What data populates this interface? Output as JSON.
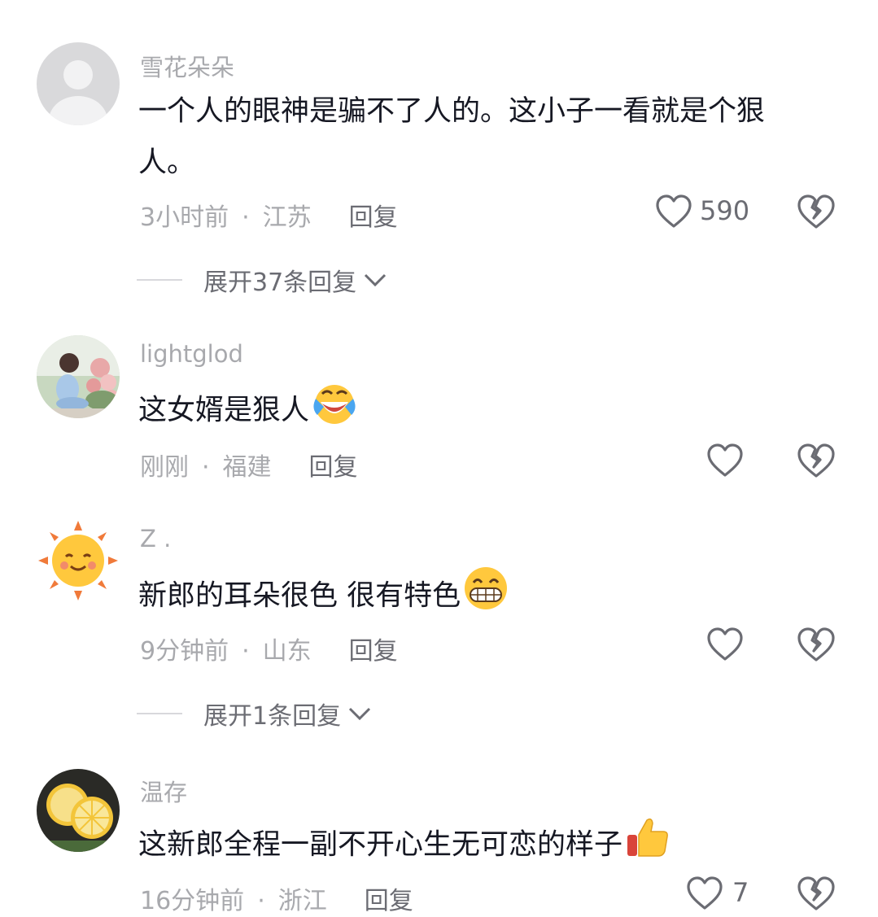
{
  "comments": [
    {
      "username": "雪花朵朵",
      "text": "一个人的眼神是骗不了人的。这小子一看就是个狠人。",
      "time": "3小时前",
      "location": "江苏",
      "reply_label": "回复",
      "like_count": "590",
      "expand_label": "展开37条回复",
      "avatar": "default-avatar"
    },
    {
      "username": "lightglod",
      "text": "这女婿是狠人",
      "emoji": "laughing-crying-emoji",
      "time": "刚刚",
      "location": "福建",
      "reply_label": "回复",
      "avatar": "girl-with-flowers-avatar"
    },
    {
      "username": "Z .",
      "text": "新郎的耳朵很色 很有特色",
      "emoji": "grinning-teeth-emoji",
      "time": "9分钟前",
      "location": "山东",
      "reply_label": "回复",
      "expand_label": "展开1条回复",
      "avatar": "smiling-sun-avatar"
    },
    {
      "username": "温存",
      "text": "这新郎全程一副不开心生无可恋的样子",
      "emoji": "thumbs-up-emoji",
      "time": "16分钟前",
      "location": "浙江",
      "reply_label": "回复",
      "like_count": "7",
      "avatar": "lemon-avatar"
    }
  ],
  "separator": "·",
  "colors": {
    "text_primary": "#161823",
    "text_secondary": "#a8a9ad",
    "icon": "#6b6c73"
  }
}
